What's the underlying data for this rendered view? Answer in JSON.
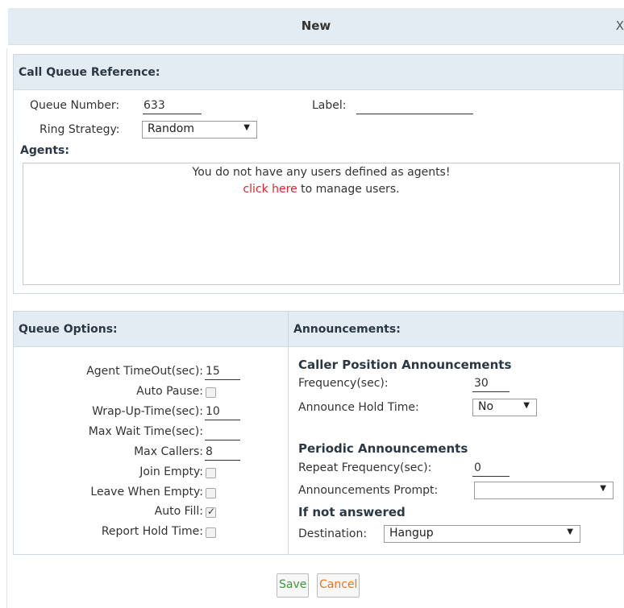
{
  "dialog": {
    "title": "New",
    "close_label": "X"
  },
  "call_queue_reference": {
    "heading": "Call Queue Reference:",
    "queue_number_label": "Queue Number:",
    "queue_number_value": "633",
    "label_label": "Label:",
    "label_value": "",
    "ring_strategy_label": "Ring Strategy:",
    "ring_strategy_value": "Random",
    "agents_label": "Agents:",
    "agents_message": "You do not have any users defined as agents!",
    "agents_link": "click here",
    "agents_link_suffix": " to manage users."
  },
  "queue_options": {
    "heading": "Queue Options:",
    "agent_timeout_label": "Agent TimeOut(sec):",
    "agent_timeout_value": "15",
    "auto_pause_label": "Auto Pause:",
    "auto_pause_checked": false,
    "wrap_up_label": "Wrap-Up-Time(sec):",
    "wrap_up_value": "10",
    "max_wait_label": "Max Wait Time(sec):",
    "max_wait_value": "",
    "max_callers_label": "Max Callers:",
    "max_callers_value": "8",
    "join_empty_label": "Join Empty:",
    "join_empty_checked": false,
    "leave_when_empty_label": "Leave When Empty:",
    "leave_when_empty_checked": false,
    "auto_fill_label": "Auto Fill:",
    "auto_fill_checked": true,
    "report_hold_time_label": "Report Hold Time:",
    "report_hold_time_checked": false
  },
  "announcements": {
    "heading": "Announcements:",
    "caller_position_heading": "Caller Position Announcements",
    "frequency_label": "Frequency(sec):",
    "frequency_value": "30",
    "announce_hold_time_label": "Announce Hold Time:",
    "announce_hold_time_value": "No",
    "periodic_heading": "Periodic Announcements",
    "repeat_frequency_label": "Repeat Frequency(sec):",
    "repeat_frequency_value": "0",
    "prompt_label": "Announcements Prompt:",
    "prompt_value": "",
    "if_not_answered_heading": "If not answered",
    "destination_label": "Destination:",
    "destination_value": "Hangup"
  },
  "buttons": {
    "save": "Save",
    "cancel": "Cancel"
  },
  "colors": {
    "header_bg": "#e3ecf2",
    "link": "#d9262c",
    "save_text": "#3a9a3a",
    "cancel_text": "#e8751e"
  }
}
